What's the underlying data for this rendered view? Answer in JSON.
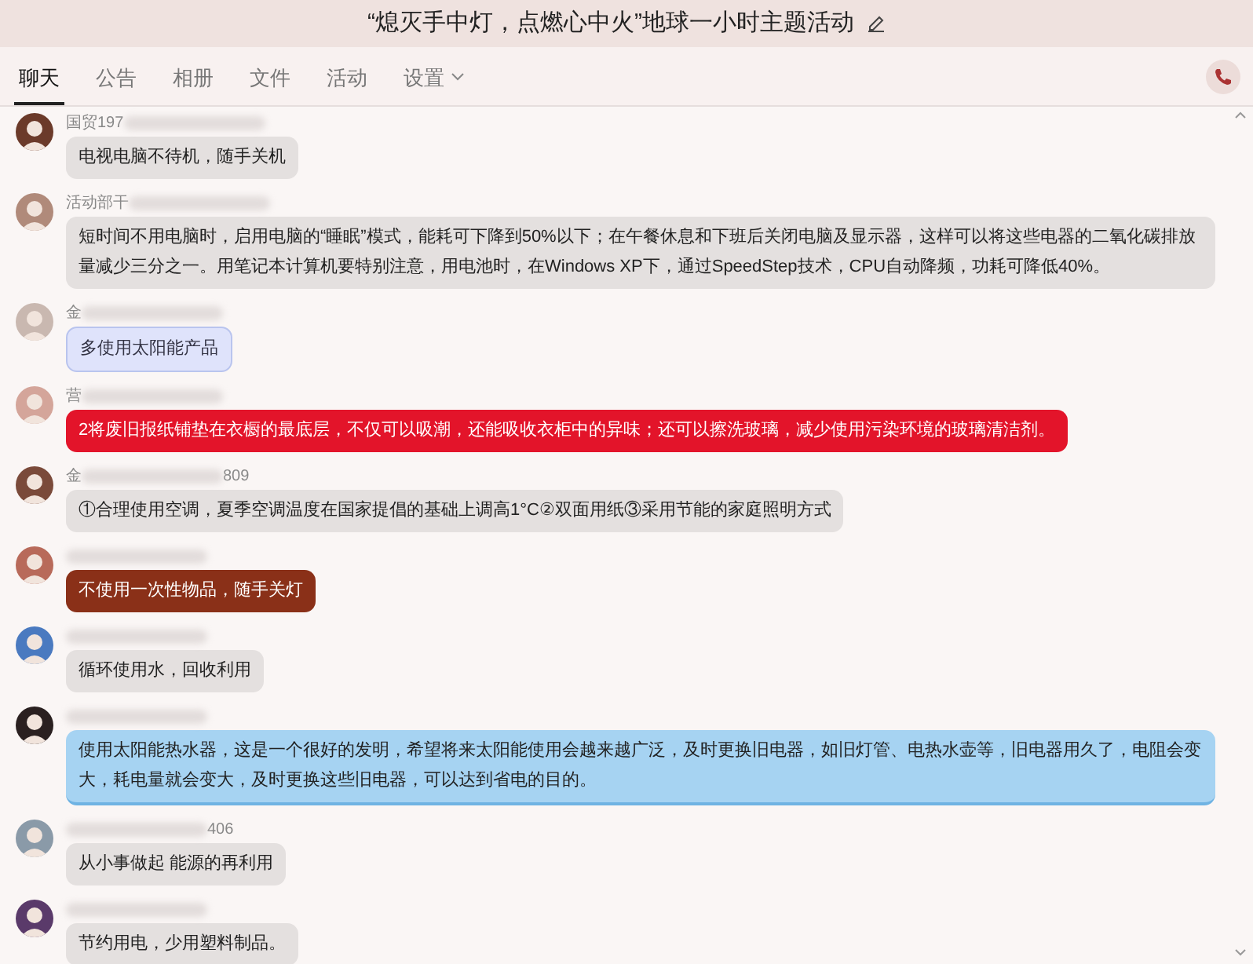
{
  "window": {
    "title": "“熄灭手中灯，点燃心中火”地球一小时主题活动"
  },
  "tabs": [
    {
      "label": "聊天",
      "selected": true
    },
    {
      "label": "公告",
      "selected": false
    },
    {
      "label": "相册",
      "selected": false
    },
    {
      "label": "文件",
      "selected": false
    },
    {
      "label": "活动",
      "selected": false
    },
    {
      "label": "设置",
      "selected": false,
      "dropdown": true
    }
  ],
  "messages": [
    {
      "sender": "国贸197",
      "text": "电视电脑不待机，随手关机",
      "kind": "plain"
    },
    {
      "sender": "活动部干",
      "text": "短时间不用电脑时，启用电脑的“睡眠”模式，能耗可下降到50%以下；在午餐休息和下班后关闭电脑及显示器，这样可以将这些电器的二氧化碳排放量减少三分之一。用笔记本计算机要特别注意，用电池时，在Windows XP下，通过SpeedStep技术，CPU自动降频，功耗可降低40%。",
      "kind": "plain"
    },
    {
      "sender": "金",
      "text": "多使用太阳能产品",
      "kind": "lavender"
    },
    {
      "sender": "营",
      "text": "2将废旧报纸铺垫在衣橱的最底层，不仅可以吸潮，还能吸收衣柜中的异味；还可以擦洗玻璃，减少使用污染环境的玻璃清洁剂。",
      "kind": "red"
    },
    {
      "sender": "金",
      "sender_tail": "809",
      "text": "①合理使用空调，夏季空调温度在国家提倡的基础上调高1°C②双面用纸③采用节能的家庭照明方式",
      "kind": "plain"
    },
    {
      "text": "不使用一次性物品，随手关灯",
      "kind": "brown"
    },
    {
      "text": "循环使用水，回收利用",
      "kind": "plain"
    },
    {
      "text": "使用太阳能热水器，这是一个很好的发明，希望将来太阳能使用会越来越广泛，及时更换旧电器，如旧灯管、电热水壶等，旧电器用久了，电阻会变大，耗电量就会变大，及时更换这些旧电器，可以达到省电的目的。",
      "kind": "blue"
    },
    {
      "sender_tail": "406",
      "text": "从小事做起 能源的再利用",
      "kind": "plain"
    },
    {
      "text": "节约用电，少用塑料制品。",
      "kind": "plain"
    }
  ]
}
